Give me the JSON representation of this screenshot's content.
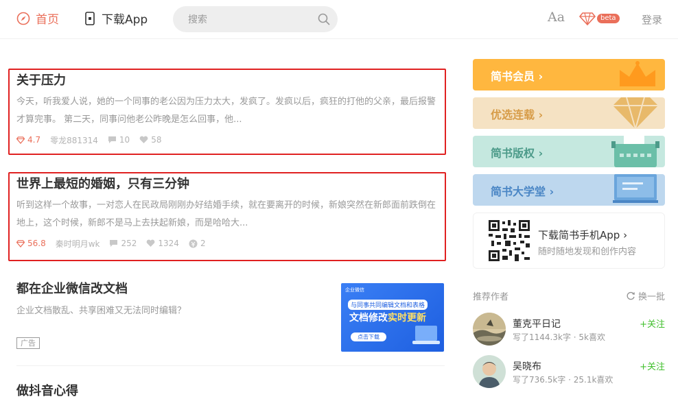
{
  "header": {
    "home_label": "首页",
    "app_label": "下载App",
    "search_placeholder": "搜索",
    "font_label": "Aa",
    "beta_label": "beta",
    "login_label": "登录"
  },
  "articles": [
    {
      "title": "关于压力",
      "abstract": "今天，听我爱人说，她的一个同事的老公因为压力太大，发疯了。发疯以后，疯狂的打他的父亲，最后报警才算完事。 第二天，同事问他老公昨晚是怎么回事，他...",
      "score": "4.7",
      "author": "零龙881314",
      "comments": "10",
      "likes": "58"
    },
    {
      "title": "世界上最短的婚姻，只有三分钟",
      "abstract": "听到这样一个故事，一对恋人在民政局刚刚办好结婚手续，就在要离开的时候，新娘突然在新郎面前跌倒在地上，这个时候，新郎不是马上去扶起新娘，而是哈哈大...",
      "score": "56.8",
      "author": "秦时明月wk",
      "comments": "252",
      "likes": "1324",
      "rewards": "2"
    }
  ],
  "ad": {
    "title": "都在企业微信改文档",
    "description": "企业文档散乱、共享困难又无法同时编辑？",
    "tag": "广告",
    "banner_logo": "企业微信",
    "banner_line1": "与同事共同编辑文档和表格",
    "banner_line2_a": "文档修改",
    "banner_line2_b": "实时更新",
    "banner_cta": "点击下载"
  },
  "next_article_title": "做抖音心得",
  "sidebar": {
    "boards": [
      {
        "label": "简书会员 ›",
        "color": "#ffb73f"
      },
      {
        "label": "优选连载 ›",
        "color": "#f5e2c3"
      },
      {
        "label": "简书版权 ›",
        "color": "#c5e8df"
      },
      {
        "label": "简书大学堂 ›",
        "color": "#bdd7ee"
      }
    ],
    "app_download": {
      "title": "下载简书手机App ›",
      "description": "随时随地发现和创作内容"
    },
    "recommend": {
      "title": "推荐作者",
      "refresh_label": "换一批",
      "authors": [
        {
          "name": "董克平日记",
          "stats": "写了1144.3k字 · 5k喜欢",
          "follow": "+关注"
        },
        {
          "name": "吴晓布",
          "stats": "写了736.5k字 · 25.1k喜欢",
          "follow": "+关注"
        }
      ]
    }
  },
  "colors": {
    "accent": "#ea6f5a",
    "follow": "#42c02e",
    "highlight_border": "#e02020"
  }
}
